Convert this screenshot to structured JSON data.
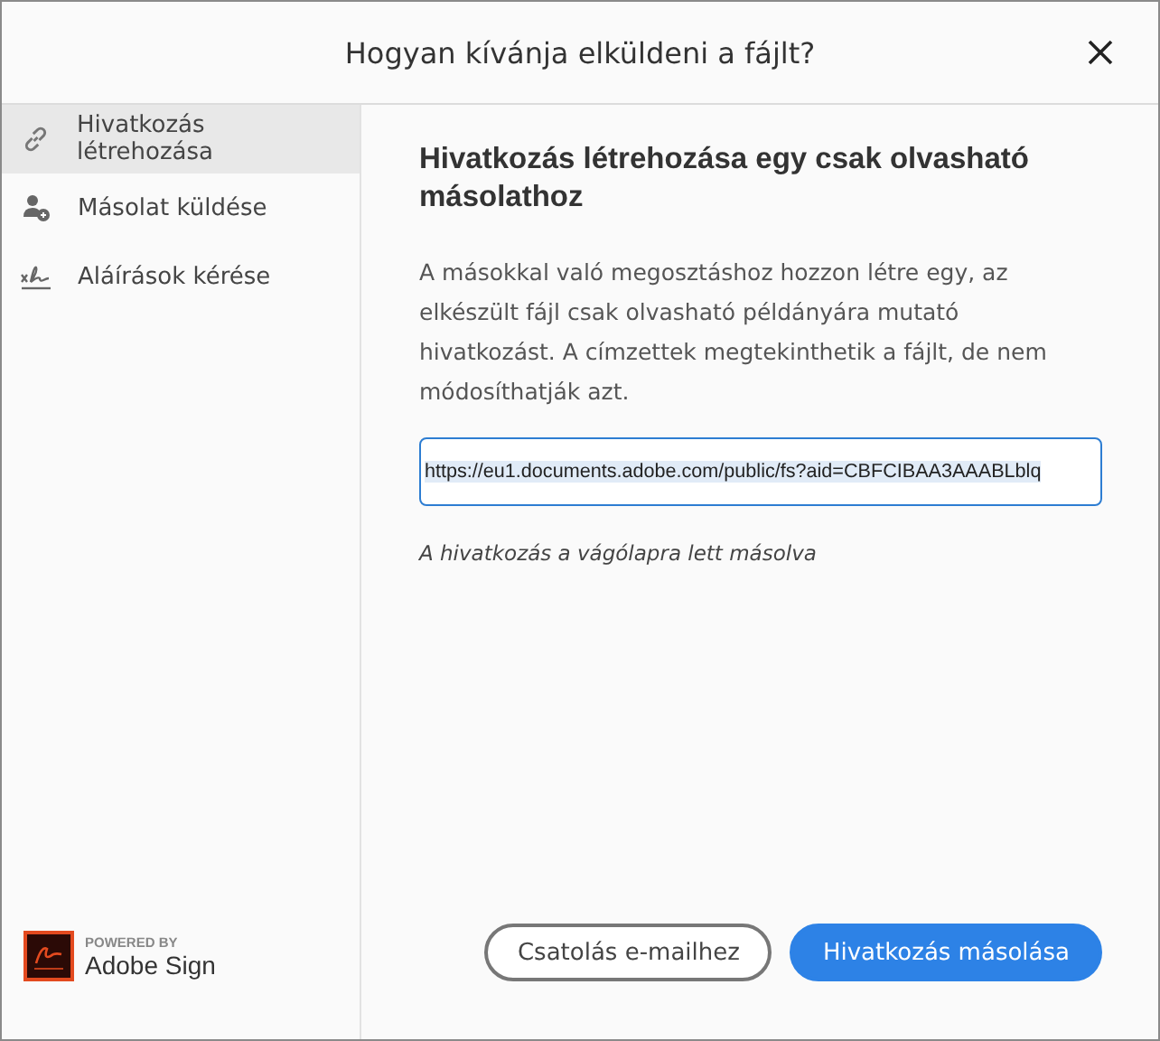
{
  "window": {
    "title": "Hogyan kívánja elküldeni a fájlt?"
  },
  "sidebar": {
    "items": [
      {
        "label": "Hivatkozás létrehozása",
        "kind": "link",
        "selected": true
      },
      {
        "label": "Másolat küldése",
        "kind": "person",
        "selected": false
      },
      {
        "label": "Aláírások kérése",
        "kind": "signature",
        "selected": false
      }
    ],
    "branding": {
      "caption": "POWERED BY",
      "product": "Adobe Sign"
    }
  },
  "content": {
    "heading": "Hivatkozás létrehozása egy csak olvasható másolathoz",
    "description": "A másokkal való megosztáshoz hozzon létre egy, az elkészült fájl csak olvasható példányára mutató hivatkozást. A címzettek megtekinthetik a fájlt, de nem módosíthatják azt.",
    "link_field": {
      "value": "https://eu1.documents.adobe.com/public/fs?aid=CBFCIBAA3AAABLblq",
      "selected": true
    },
    "status": "A hivatkozás a vágólapra lett másolva"
  },
  "buttons": [
    {
      "label": "Csatolás e-mailhez",
      "kind": "secondary"
    },
    {
      "label": "Hivatkozás másolása",
      "kind": "primary"
    }
  ]
}
